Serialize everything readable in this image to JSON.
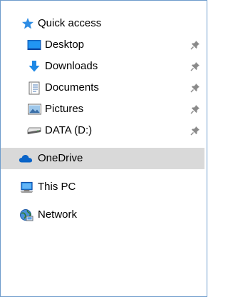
{
  "nav": {
    "quick_access": {
      "label": "Quick access",
      "icon": "star-icon",
      "items": [
        {
          "label": "Desktop",
          "icon": "desktop-icon",
          "pinned": true
        },
        {
          "label": "Downloads",
          "icon": "download-arrow-icon",
          "pinned": true
        },
        {
          "label": "Documents",
          "icon": "documents-icon",
          "pinned": true
        },
        {
          "label": "Pictures",
          "icon": "pictures-icon",
          "pinned": true
        },
        {
          "label": "DATA (D:)",
          "icon": "drive-icon",
          "pinned": true
        }
      ]
    },
    "onedrive": {
      "label": "OneDrive",
      "icon": "cloud-icon",
      "selected": true
    },
    "this_pc": {
      "label": "This PC",
      "icon": "computer-icon"
    },
    "network": {
      "label": "Network",
      "icon": "network-icon"
    }
  },
  "colors": {
    "accent_blue": "#1e88e5",
    "selection_bg": "#d9d9d9",
    "border": "#6e9ccc",
    "pin_gray": "#8a8a8a"
  }
}
